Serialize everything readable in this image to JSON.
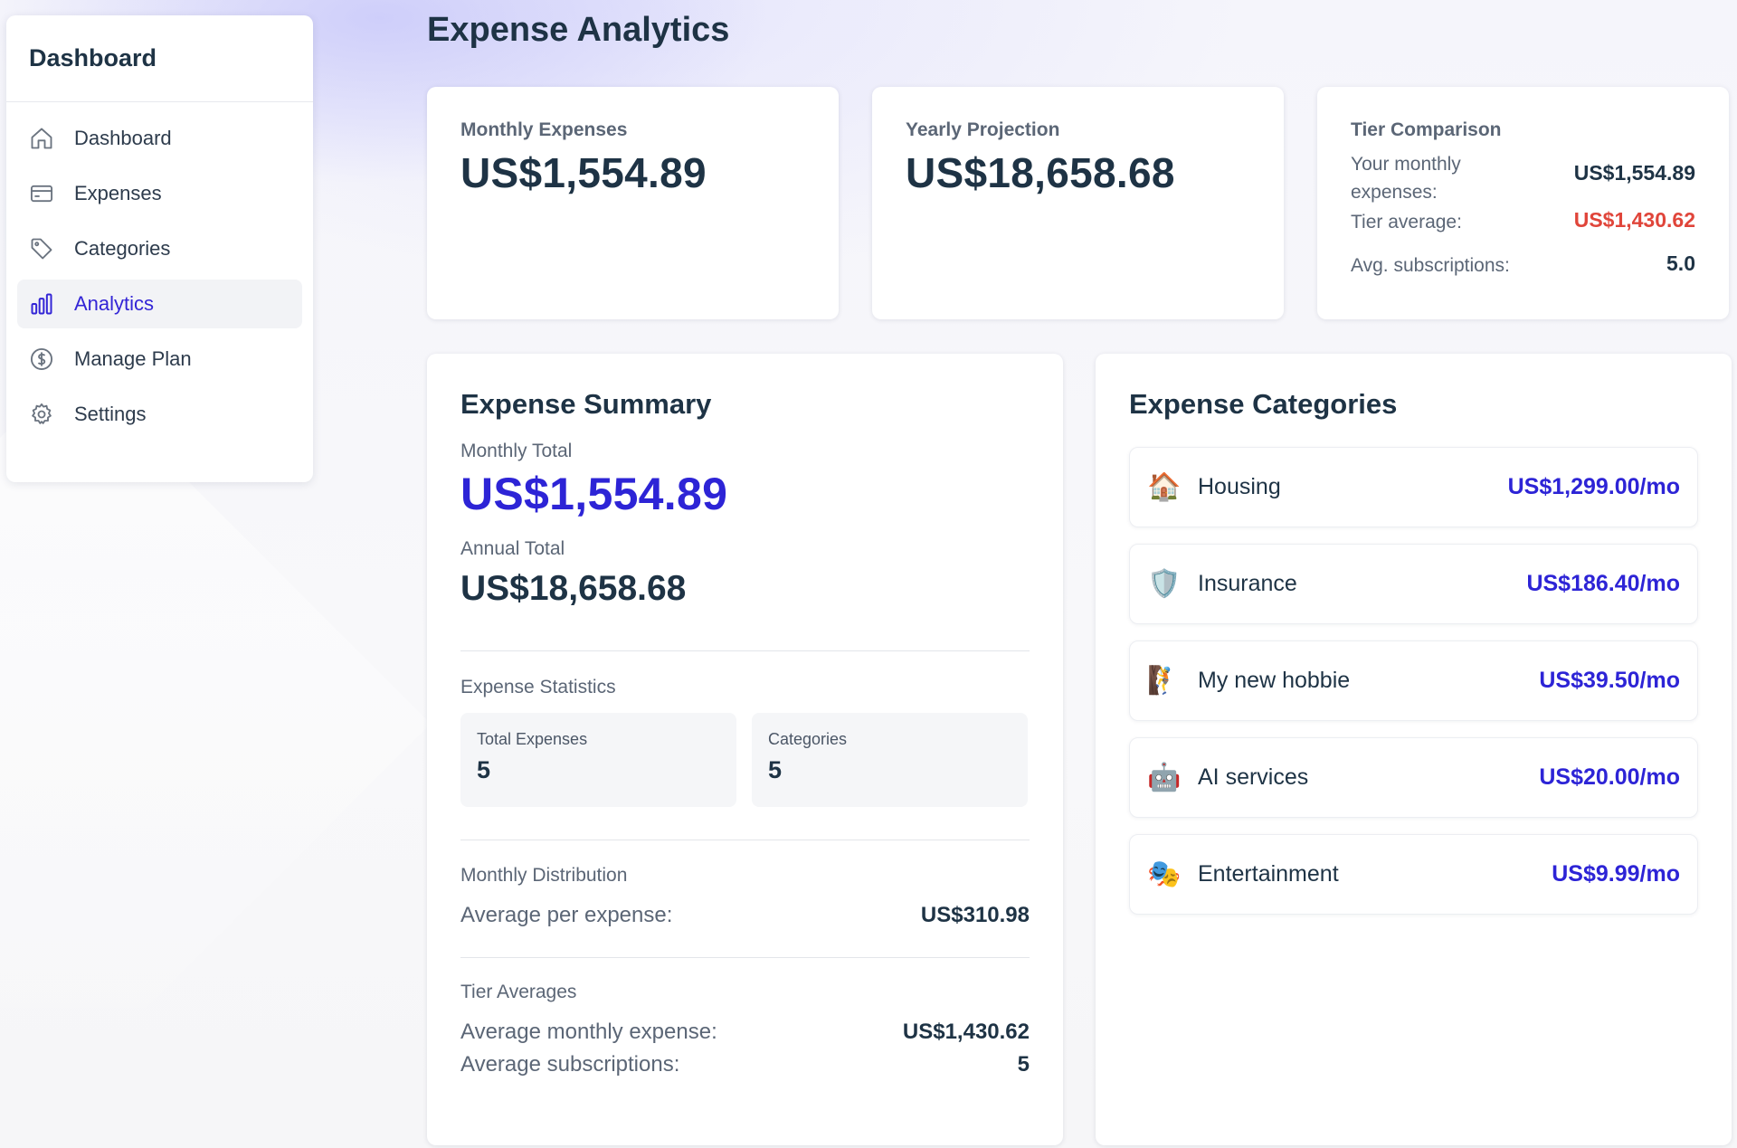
{
  "page": {
    "title": "Expense Analytics"
  },
  "sidebar": {
    "title": "Dashboard",
    "items": [
      {
        "label": "Dashboard",
        "icon": "home-icon",
        "active": false
      },
      {
        "label": "Expenses",
        "icon": "credit-card-icon",
        "active": false
      },
      {
        "label": "Categories",
        "icon": "tag-icon",
        "active": false
      },
      {
        "label": "Analytics",
        "icon": "bar-chart-icon",
        "active": true
      },
      {
        "label": "Manage Plan",
        "icon": "dollar-circle-icon",
        "active": false
      },
      {
        "label": "Settings",
        "icon": "gear-icon",
        "active": false
      }
    ]
  },
  "stats": {
    "monthly": {
      "label": "Monthly Expenses",
      "value": "US$1,554.89"
    },
    "yearly": {
      "label": "Yearly Projection",
      "value": "US$18,658.68"
    },
    "tier": {
      "label": "Tier Comparison",
      "your_label": "Your monthly expenses:",
      "your_value": "US$1,554.89",
      "avg_label": "Tier average:",
      "avg_value": "US$1,430.62",
      "subs_label": "Avg. subscriptions:",
      "subs_value": "5.0"
    }
  },
  "summary": {
    "title": "Expense Summary",
    "monthly_label": "Monthly Total",
    "monthly_value": "US$1,554.89",
    "annual_label": "Annual Total",
    "annual_value": "US$18,658.68",
    "statistics_label": "Expense Statistics",
    "total_expenses_label": "Total Expenses",
    "total_expenses_value": "5",
    "categories_label": "Categories",
    "categories_value": "5",
    "distribution_label": "Monthly Distribution",
    "avg_per_label": "Average per expense:",
    "avg_per_value": "US$310.98",
    "tier_averages_label": "Tier Averages",
    "avg_monthly_label": "Average monthly expense:",
    "avg_monthly_value": "US$1,430.62",
    "avg_subs_label": "Average subscriptions:",
    "avg_subs_value": "5"
  },
  "categories": {
    "title": "Expense Categories",
    "items": [
      {
        "icon": "🏠",
        "icon_name": "house-icon",
        "name": "Housing",
        "amount": "US$1,299.00/mo"
      },
      {
        "icon": "🛡️",
        "icon_name": "shield-icon",
        "name": "Insurance",
        "amount": "US$186.40/mo"
      },
      {
        "icon": "🧗",
        "icon_name": "climbing-icon",
        "name": "My new hobbie",
        "amount": "US$39.50/mo"
      },
      {
        "icon": "🤖",
        "icon_name": "robot-icon",
        "name": "AI services",
        "amount": "US$20.00/mo"
      },
      {
        "icon": "🎭",
        "icon_name": "theater-masks-icon",
        "name": "Entertainment",
        "amount": "US$9.99/mo"
      }
    ]
  },
  "colors": {
    "accent": "#2d24d6",
    "danger": "#e0453a",
    "text": "#1e3345"
  }
}
